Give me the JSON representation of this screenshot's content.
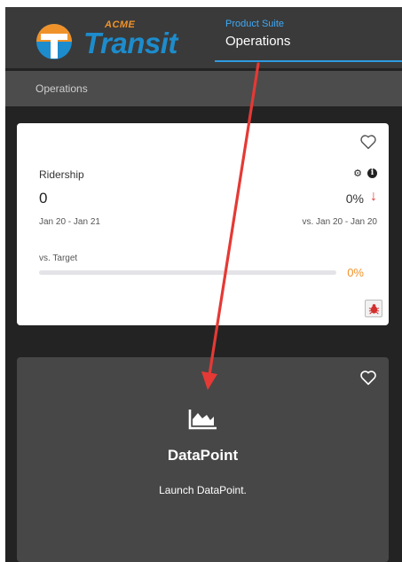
{
  "header": {
    "logo": {
      "brand_top": "ACME",
      "brand_word": "Transit"
    },
    "product_suite_label": "Product Suite",
    "product_suite_name": "Operations"
  },
  "subnav": {
    "label": "Operations"
  },
  "ridership_card": {
    "title": "Ridership",
    "value": "0",
    "change_percent": "0%",
    "date_range": "Jan 20 - Jan 21",
    "comparison_range": "vs. Jan 20 - Jan 20",
    "target_label": "vs. Target",
    "target_percent": "0%",
    "target_progress": 0,
    "icons": [
      "heart-outline-icon",
      "gear-icon",
      "info-icon",
      "arrow-down-icon",
      "bug-icon"
    ],
    "colors": {
      "down": "#e53935",
      "target": "#f0922a"
    }
  },
  "datapoint_card": {
    "title": "DataPoint",
    "description": "Launch DataPoint.",
    "icons": [
      "heart-outline-icon",
      "area-chart-icon"
    ]
  },
  "annotation": {
    "color": "#e53935"
  },
  "colors": {
    "accent": "#2e9be0",
    "brand_blue": "#1d8ccc",
    "brand_orange": "#f0922a"
  }
}
